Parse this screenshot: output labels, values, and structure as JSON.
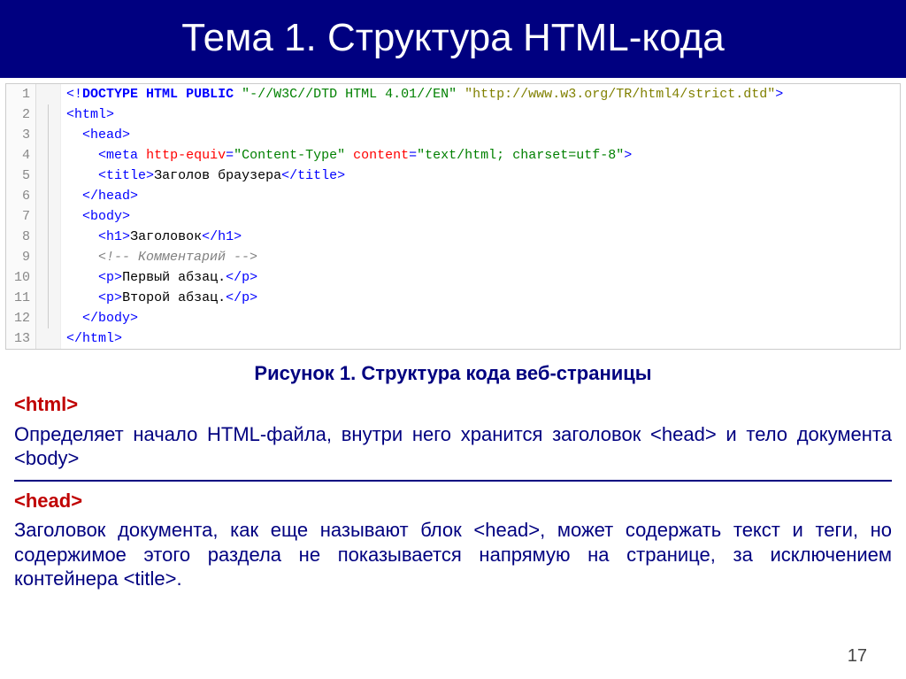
{
  "title": "Тема 1. Структура HTML-кода",
  "caption": "Рисунок 1. Структура кода веб-страницы",
  "code": {
    "lines": [
      "1",
      "2",
      "3",
      "4",
      "5",
      "6",
      "7",
      "8",
      "9",
      "10",
      "11",
      "12",
      "13"
    ],
    "l1": {
      "doctype": "DOCTYPE",
      "html": "HTML",
      "public": "PUBLIC",
      "fpi": "\"-//W3C//DTD HTML 4.01//EN\"",
      "url": "\"http://www.w3.org/TR/html4/strict.dtd\""
    },
    "l2": {
      "tag": "html"
    },
    "l3": {
      "tag": "head"
    },
    "l4": {
      "tag": "meta",
      "attr1": "http-equiv",
      "val1": "\"Content-Type\"",
      "attr2": "content",
      "val2": "\"text/html; charset=utf-8\""
    },
    "l5": {
      "open": "title",
      "text": "Заголов браузера",
      "close": "title"
    },
    "l6": {
      "tag": "head"
    },
    "l7": {
      "tag": "body"
    },
    "l8": {
      "open": "h1",
      "text": "Заголовок",
      "close": "h1"
    },
    "l9": {
      "comment": "<!-- Комментарий -->"
    },
    "l10": {
      "open": "p",
      "text": "Первый абзац.",
      "close": "p"
    },
    "l11": {
      "open": "p",
      "text": "Второй абзац.",
      "close": "p"
    },
    "l12": {
      "tag": "body"
    },
    "l13": {
      "tag": "html"
    }
  },
  "desc": {
    "html_tag": "<html>",
    "html_text_1": "Определяет начало HTML-файла, внутри него хранится заголовок ",
    "html_inline_1": "<head>",
    "html_text_2": " и тело документа ",
    "html_inline_2": "<body>",
    "head_tag": "<head>",
    "head_text_1": "Заголовок документа, как еще называют блок ",
    "head_inline_1": "<head>",
    "head_text_2": ", может содержать текст и теги, но содержимое этого раздела не показывается напрямую на странице, за исключением контейнера ",
    "head_inline_2": "<title>",
    "head_text_3": "."
  },
  "page_number": "17"
}
